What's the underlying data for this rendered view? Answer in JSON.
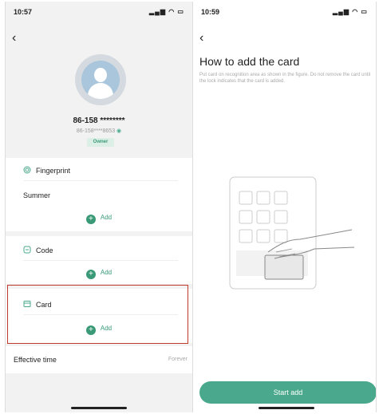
{
  "left_screen": {
    "status": {
      "time": "10:57",
      "icons": "▂▄▆ ◠ ▭"
    },
    "profile": {
      "name": "86-158 ********",
      "phone": "86-158****8653",
      "role_badge": "Owner"
    },
    "fingerprint": {
      "title": "Fingerprint",
      "entry": "Summer",
      "add_label": "Add"
    },
    "code": {
      "title": "Code",
      "add_label": "Add"
    },
    "card": {
      "title": "Card",
      "add_label": "Add"
    },
    "effective_time": {
      "label": "Effective time",
      "value": "Forever"
    }
  },
  "right_screen": {
    "status": {
      "time": "10:59",
      "icons": "▂▄▆ ◠ ▭"
    },
    "title": "How to add the card",
    "description": "Put card on recognition area as shown in the figure. Do not remove the card until the lock indicates that the card is added.",
    "start_button": "Start add"
  },
  "colors": {
    "accent": "#4aa98c",
    "highlight_border": "#c0392b"
  }
}
